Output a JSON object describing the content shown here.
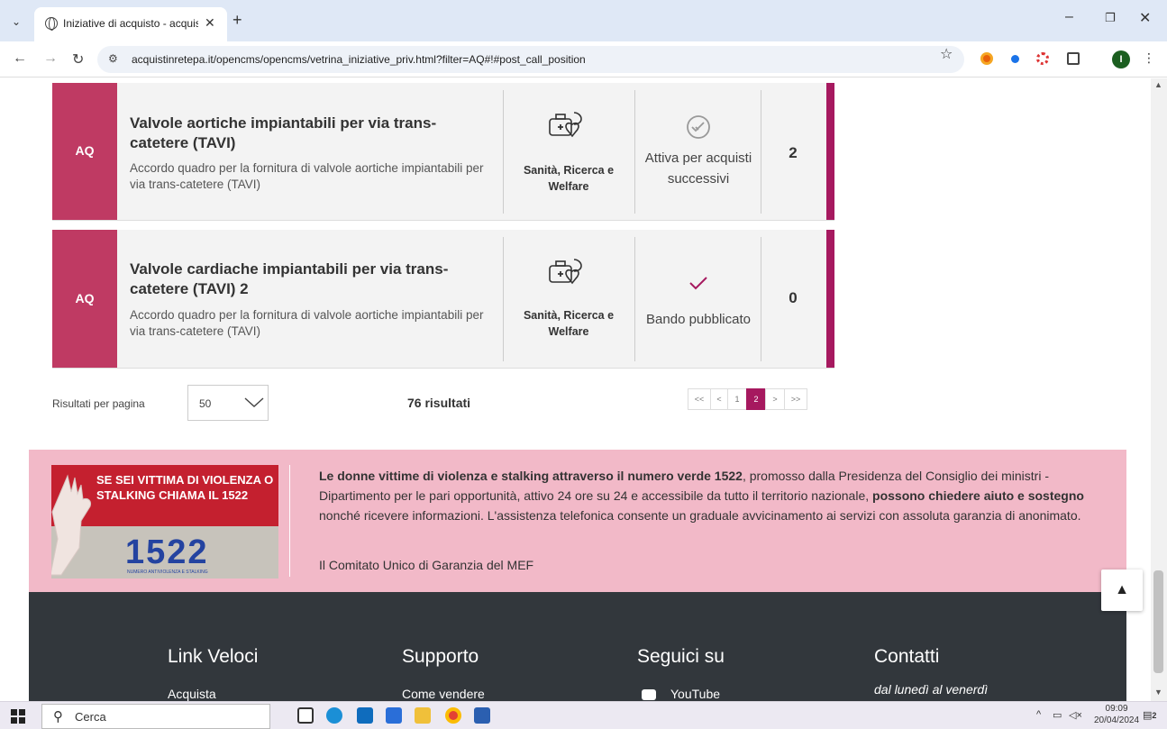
{
  "browser": {
    "tab_title": "Iniziative di acquisto - acquisti",
    "new_tab": "+",
    "url": "acquistinretepa.it/opencms/opencms/vetrina_iniziative_priv.html?filter=AQ#!#post_call_position",
    "profile_initial": "I"
  },
  "rows": [
    {
      "badge": "AQ",
      "title": "Valvole aortiche impiantabili per via trans-catetere (TAVI)",
      "description": "Accordo quadro per la fornitura di valvole aortiche impiantabili per via trans-catetere (TAVI)",
      "category": "Sanità, Ricerca e Welfare",
      "category_icon": "medical-kit-heart-icon",
      "status": "Attiva per acquisti successivi",
      "status_icon": "double-check-circle-icon",
      "count": "2"
    },
    {
      "badge": "AQ",
      "title": "Valvole cardiache impiantabili per via trans-catetere (TAVI) 2",
      "description": "Accordo quadro per la fornitura di valvole aortiche impiantabili per via trans-catetere (TAVI)",
      "category": "Sanità, Ricerca e Welfare",
      "category_icon": "medical-kit-heart-icon",
      "status": "Bando pubblicato",
      "status_icon": "checkmark-icon",
      "count": "0"
    }
  ],
  "pagination": {
    "results_per_page_label": "Risultati per pagina",
    "results_per_page_value": "50",
    "total_label": "76 risultati",
    "first": "<<",
    "prev": "<",
    "pages": [
      "1",
      "2"
    ],
    "current_page": "2",
    "next": ">",
    "last": ">>"
  },
  "banner": {
    "image_heading": "SE SEI VITTIMA DI VIOLENZA O STALKING CHIAMA IL 1522",
    "image_number": "1522",
    "image_small": "NUMERO ANTIVIOLENZA E STALKING",
    "text_bold_1": "Le donne vittime di violenza e stalking attraverso il numero verde 1522",
    "text_1": ", promosso dalla Presidenza del Consiglio dei ministri - Dipartimento per le pari opportunità, attivo 24 ore su 24 e accessibile da tutto il territorio nazionale, ",
    "text_bold_2": "possono chiedere aiuto e sostegno",
    "text_2": " nonché ricevere informazioni. L'assistenza telefonica consente un graduale avvicinamento ai servizi con assoluta garanzia di anonimato.",
    "link": "Il Comitato Unico di Garanzia del MEF"
  },
  "footer": {
    "col1": "Link Veloci",
    "col2": "Supporto",
    "col3": "Seguici su",
    "col4": "Contatti",
    "col1_item": "Acquista",
    "col2_item": "Come vendere",
    "col3_item": "YouTube",
    "col4_item": "dal lunedì al venerdì"
  },
  "taskbar": {
    "search_placeholder": "Cerca",
    "time": "09:09",
    "date": "20/04/2024",
    "notifications": "2"
  },
  "colors": {
    "brand": "#a6195f",
    "badge": "#bf3a63",
    "banner_bg": "#f2b9c8",
    "footer_bg": "#32373c"
  }
}
